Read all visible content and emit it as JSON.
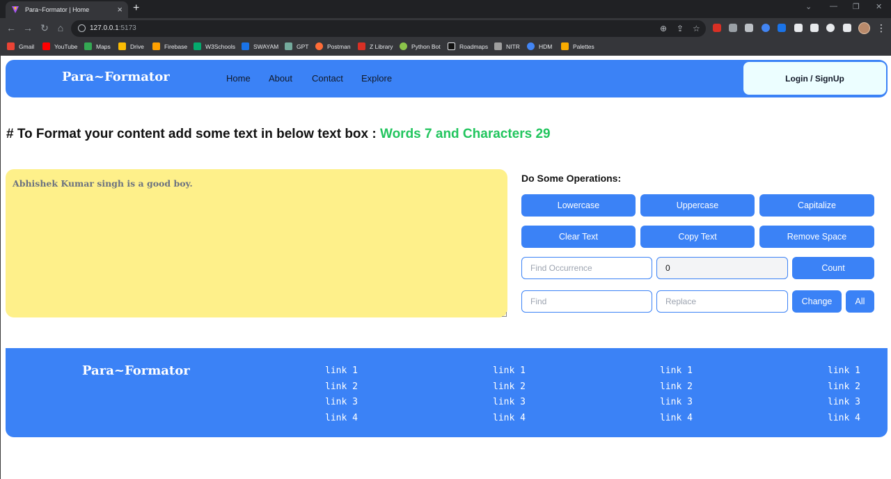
{
  "browser": {
    "tab_title": "Para~Formator | Home",
    "url_host": "127.0.0.1",
    "url_port": ":5173",
    "bookmarks": [
      {
        "label": "Gmail",
        "color": "#ea4335"
      },
      {
        "label": "YouTube",
        "color": "#ff0000"
      },
      {
        "label": "Maps",
        "color": "#34a853"
      },
      {
        "label": "Drive",
        "color": "#fbbc04"
      },
      {
        "label": "Firebase",
        "color": "#ffa000"
      },
      {
        "label": "W3Schools",
        "color": "#04aa6d"
      },
      {
        "label": "SWAYAM",
        "color": "#1a73e8"
      },
      {
        "label": "GPT",
        "color": "#74aa9c"
      },
      {
        "label": "Postman",
        "color": "#ff6c37"
      },
      {
        "label": "Z Library",
        "color": "#d93025"
      },
      {
        "label": "Python Bot",
        "color": "#8bc34a"
      },
      {
        "label": "Roadmaps",
        "color": "#111111"
      },
      {
        "label": "NITR",
        "color": "#9e9e9e"
      },
      {
        "label": "HDM",
        "color": "#4285f4"
      },
      {
        "label": "Palettes",
        "color": "#f9ab00"
      }
    ]
  },
  "navbar": {
    "brand": "Para~Formator",
    "links": [
      "Home",
      "About",
      "Contact",
      "Explore"
    ],
    "login_label": "Login / SignUp"
  },
  "main": {
    "heading": "# To Format your content add some text in below text box : ",
    "stats": "Words 7 and Characters 29",
    "text": "Abhishek Kumar singh is a good boy.",
    "ops_title": "Do Some Operations:",
    "buttons": {
      "lowercase": "Lowercase",
      "uppercase": "Uppercase",
      "capitalize": "Capitalize",
      "clear": "Clear Text",
      "copy": "Copy Text",
      "remove_space": "Remove Space",
      "count": "Count",
      "change": "Change",
      "all": "All"
    },
    "find_occurrence_placeholder": "Find Occurrence",
    "occurrence_count": "0",
    "find_placeholder": "Find",
    "replace_placeholder": "Replace"
  },
  "footer": {
    "brand": "Para~Formator",
    "columns": [
      [
        "link 1",
        "link 2",
        "link 3",
        "link 4"
      ],
      [
        "link 1",
        "link 2",
        "link 3",
        "link 4"
      ],
      [
        "link 1",
        "link 2",
        "link 3",
        "link 4"
      ],
      [
        "link 1",
        "link 2",
        "link 3",
        "link 4"
      ]
    ]
  },
  "colors": {
    "primary": "#3b82f6",
    "textbox": "#fef08a",
    "stats": "#22c55e",
    "login_bg": "#ecfeff"
  }
}
